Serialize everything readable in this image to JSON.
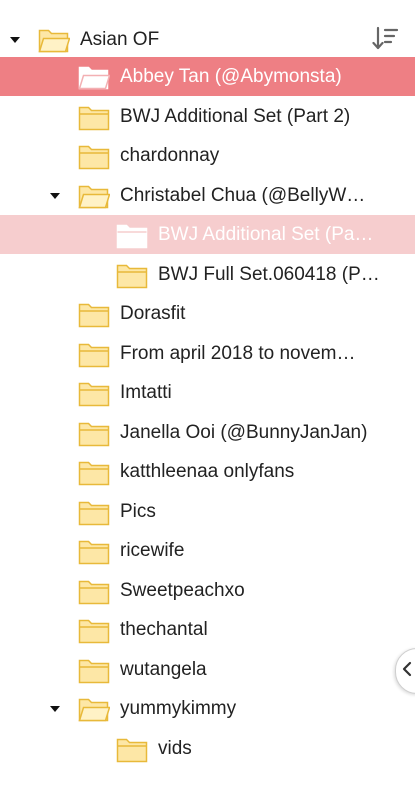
{
  "root": {
    "label": "Asian OF"
  },
  "items": [
    {
      "label": "Abbey Tan (@Abymonsta)"
    },
    {
      "label": "BWJ Additional Set (Part 2)"
    },
    {
      "label": "chardonnay"
    },
    {
      "label": "Christabel Chua (@BellyW…"
    },
    {
      "label": "BWJ Additional Set (Pa…"
    },
    {
      "label": "BWJ Full Set.060418 (P…"
    },
    {
      "label": "Dorasfit"
    },
    {
      "label": "From april 2018 to novem…"
    },
    {
      "label": "Imtatti"
    },
    {
      "label": "Janella Ooi (@BunnyJanJan)"
    },
    {
      "label": "katthleenaa onlyfans"
    },
    {
      "label": "Pics"
    },
    {
      "label": "ricewife"
    },
    {
      "label": "Sweetpeachxo"
    },
    {
      "label": "thechantal"
    },
    {
      "label": "wutangela"
    },
    {
      "label": "yummykimmy"
    },
    {
      "label": "vids"
    }
  ],
  "icons": {
    "sort": "sort-descending-icon",
    "collapse_tab": "chevron-left-icon",
    "folder": "folder-icon",
    "expand": "caret-down-icon"
  },
  "colors": {
    "selected_strong": "#ee7f84",
    "selected_soft": "#f6cdce",
    "folder_fill": "#fde7a6",
    "folder_stroke": "#e8b93a"
  }
}
